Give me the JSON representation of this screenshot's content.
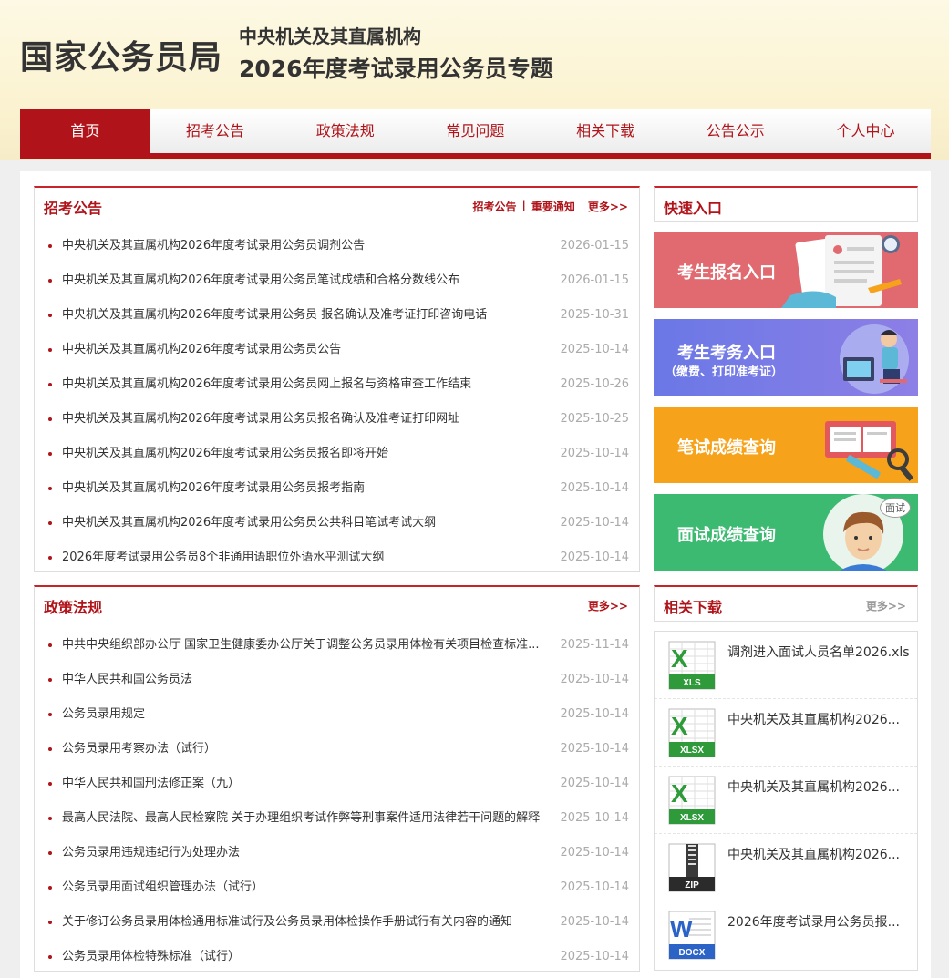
{
  "header": {
    "logo": "国家公务员局",
    "subtitle1": "中央机关及其直属机构",
    "subtitle2": "2026年度考试录用公务员专题"
  },
  "nav": [
    "首页",
    "招考公告",
    "政策法规",
    "常见问题",
    "相关下载",
    "公告公示",
    "个人中心"
  ],
  "notices": {
    "title": "招考公告",
    "link1": "招考公告",
    "sep": "|",
    "link2": "重要通知",
    "more": "更多>>",
    "items": [
      {
        "title": "中央机关及其直属机构2026年度考试录用公务员调剂公告",
        "date": "2026-01-15"
      },
      {
        "title": "中央机关及其直属机构2026年度考试录用公务员笔试成绩和合格分数线公布",
        "date": "2026-01-15"
      },
      {
        "title": "中央机关及其直属机构2026年度考试录用公务员 报名确认及准考证打印咨询电话",
        "date": "2025-10-31"
      },
      {
        "title": "中央机关及其直属机构2026年度考试录用公务员公告",
        "date": "2025-10-14"
      },
      {
        "title": "中央机关及其直属机构2026年度考试录用公务员网上报名与资格审查工作结束",
        "date": "2025-10-26"
      },
      {
        "title": "中央机关及其直属机构2026年度考试录用公务员报名确认及准考证打印网址",
        "date": "2025-10-25"
      },
      {
        "title": "中央机关及其直属机构2026年度考试录用公务员报名即将开始",
        "date": "2025-10-14"
      },
      {
        "title": "中央机关及其直属机构2026年度考试录用公务员报考指南",
        "date": "2025-10-14"
      },
      {
        "title": "中央机关及其直属机构2026年度考试录用公务员公共科目笔试考试大纲",
        "date": "2025-10-14"
      },
      {
        "title": "2026年度考试录用公务员8个非通用语职位外语水平测试大纲",
        "date": "2025-10-14"
      }
    ]
  },
  "policy": {
    "title": "政策法规",
    "more": "更多>>",
    "items": [
      {
        "title": "中共中央组织部办公厅 国家卫生健康委办公厅关于调整公务员录用体检有关项目检查标准...",
        "date": "2025-11-14"
      },
      {
        "title": "中华人民共和国公务员法",
        "date": "2025-10-14"
      },
      {
        "title": "公务员录用规定",
        "date": "2025-10-14"
      },
      {
        "title": "公务员录用考察办法（试行）",
        "date": "2025-10-14"
      },
      {
        "title": "中华人民共和国刑法修正案（九）",
        "date": "2025-10-14"
      },
      {
        "title": "最高人民法院、最高人民检察院 关于办理组织考试作弊等刑事案件适用法律若干问题的解释",
        "date": "2025-10-14"
      },
      {
        "title": "公务员录用违规违纪行为处理办法",
        "date": "2025-10-14"
      },
      {
        "title": "公务员录用面试组织管理办法（试行）",
        "date": "2025-10-14"
      },
      {
        "title": "关于修订公务员录用体检通用标准试行及公务员录用体检操作手册试行有关内容的通知",
        "date": "2025-10-14"
      },
      {
        "title": "公务员录用体检特殊标准（试行）",
        "date": "2025-10-14"
      }
    ]
  },
  "quick": {
    "title": "快速入口",
    "register": "考生报名入口",
    "affairs": "考生考务入口",
    "affairs_sub": "（缴费、打印准考证）",
    "written": "笔试成绩查询",
    "interview": "面试成绩查询",
    "interview_badge": "面试",
    "colors": {
      "register": "#e06a6f",
      "affairs": "#7b7fe8",
      "written": "#f7a21b",
      "interview": "#3cba72"
    }
  },
  "downloads": {
    "title": "相关下载",
    "more": "更多>>",
    "items": [
      {
        "name": "调剂进入面试人员名单2026.xls",
        "type": "XLS",
        "icon": "excel-icon"
      },
      {
        "name": "中央机关及其直属机构2026...",
        "type": "XLSX",
        "icon": "excel-icon"
      },
      {
        "name": "中央机关及其直属机构2026...",
        "type": "XLSX",
        "icon": "excel-icon"
      },
      {
        "name": "中央机关及其直属机构2026...",
        "type": "ZIP",
        "icon": "zip-icon"
      },
      {
        "name": "2026年度考试录用公务员报...",
        "type": "DOCX",
        "icon": "word-icon"
      }
    ]
  }
}
